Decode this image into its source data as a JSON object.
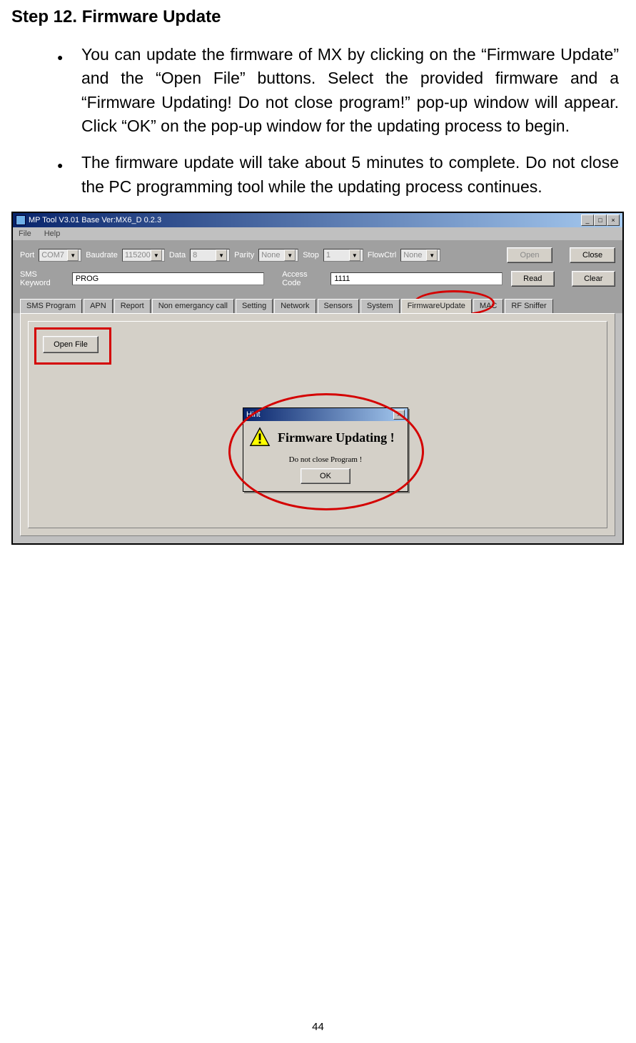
{
  "title": "Step 12. Firmware Update",
  "bullets": [
    "You can update the firmware of MX by clicking on the “Firmware Update” and the “Open File” buttons. Select the provided firmware and a “Firmware Updating! Do not close program!” pop-up window will appear. Click “OK” on the pop-up window for the updating process to begin.",
    "The firmware update will take about 5 minutes to complete. Do not close the PC programming tool while the updating process continues."
  ],
  "window": {
    "title": "MP Tool V3.01  Base Ver:MX6_D 0.2.3",
    "menu": {
      "file": "File",
      "help": "Help"
    },
    "toolbar": {
      "port_label": "Port",
      "port_value": "COM7",
      "baud_label": "Baudrate",
      "baud_value": "115200",
      "data_label": "Data",
      "data_value": "8",
      "parity_label": "Parity",
      "parity_value": "None",
      "stop_label": "Stop",
      "stop_value": "1",
      "flow_label": "FlowCtrl",
      "flow_value": "None",
      "open_btn": "Open",
      "close_btn": "Close",
      "sms_label": "SMS Keyword",
      "sms_value": "PROG",
      "access_label": "Access Code",
      "access_value": "1111",
      "read_btn": "Read",
      "clear_btn": "Clear"
    },
    "tabs": [
      "SMS Program",
      "APN",
      "Report",
      "Non emergancy call",
      "Setting",
      "Network",
      "Sensors",
      "System",
      "FirmwareUpdate",
      "MAC",
      "RF Sniffer"
    ],
    "active_tab_index": 8,
    "open_file_btn": "Open File",
    "dialog": {
      "title": "Hint",
      "main": "Firmware Updating !",
      "sub": "Do not close Program !",
      "ok": "OK"
    }
  },
  "page_number": "44"
}
